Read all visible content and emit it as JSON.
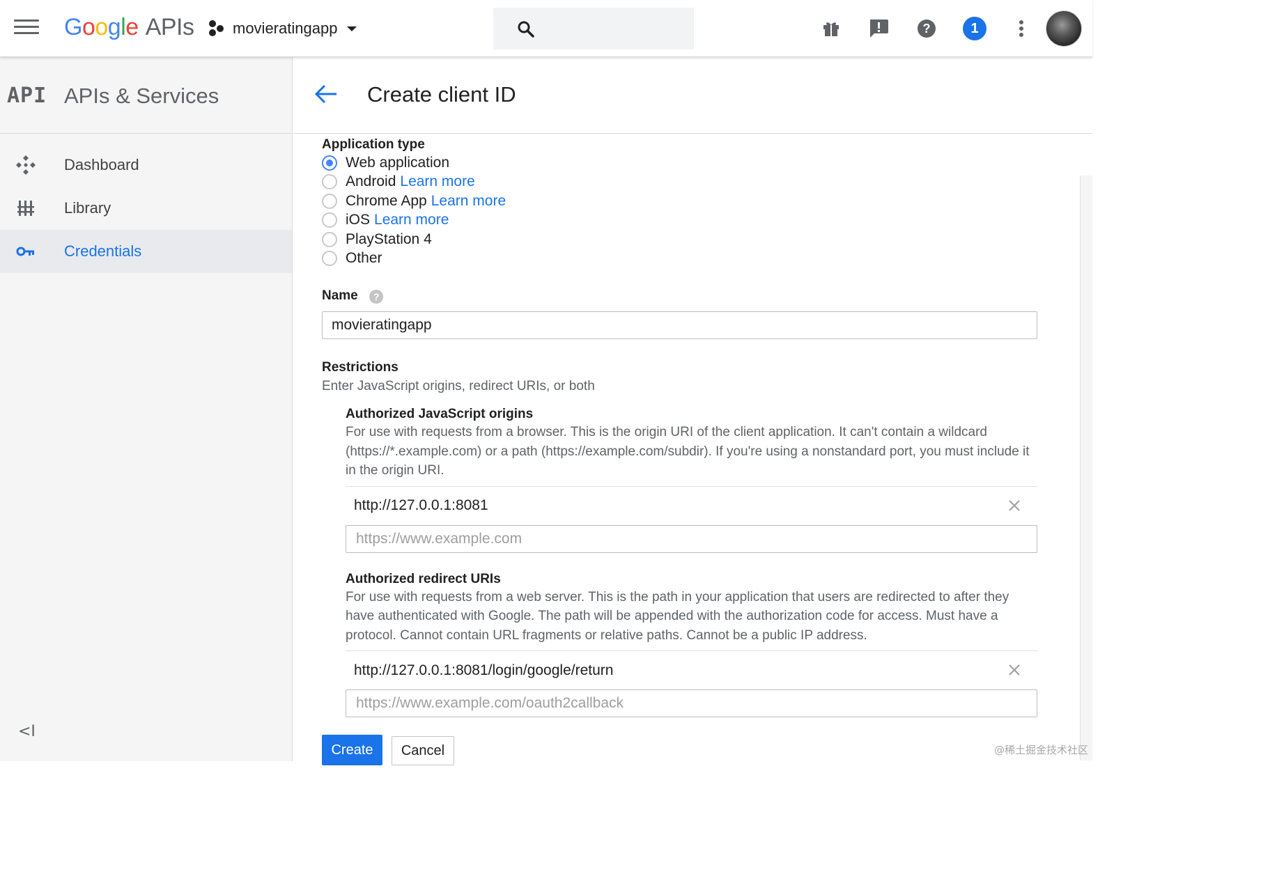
{
  "topbar": {
    "logo": {
      "g1": "G",
      "g2": "o",
      "g3": "o",
      "g4": "g",
      "g5": "l",
      "g6": "e",
      "apis": "APIs"
    },
    "project_name": "movieratingapp",
    "notification_count": "1",
    "icons": [
      "menu-icon",
      "project-icon",
      "search-icon",
      "gift-icon",
      "feedback-icon",
      "help-icon",
      "more-vert-icon"
    ]
  },
  "sidebar": {
    "logo_text": "API",
    "title": "APIs & Services",
    "items": [
      {
        "label": "Dashboard",
        "icon": "dashboard-icon"
      },
      {
        "label": "Library",
        "icon": "library-icon"
      },
      {
        "label": "Credentials",
        "icon": "key-icon",
        "active": true
      }
    ],
    "collapse_label": "<I"
  },
  "page": {
    "title": "Create client ID"
  },
  "form": {
    "app_type_label": "Application type",
    "app_types": [
      {
        "label": "Web application",
        "learn": "",
        "checked": true
      },
      {
        "label": "Android",
        "learn": "Learn more"
      },
      {
        "label": "Chrome App",
        "learn": "Learn more"
      },
      {
        "label": "iOS",
        "learn": "Learn more"
      },
      {
        "label": "PlayStation 4",
        "learn": ""
      },
      {
        "label": "Other",
        "learn": ""
      }
    ],
    "name_label": "Name",
    "name_help": "?",
    "name_value": "movieratingapp",
    "restrictions_label": "Restrictions",
    "restrictions_sub": "Enter JavaScript origins, redirect URIs, or both",
    "js_origins": {
      "title": "Authorized JavaScript origins",
      "description": "For use with requests from a browser. This is the origin URI of the client application. It can't contain a wildcard (https://*.example.com) or a path (https://example.com/subdir). If you're using a nonstandard port, you must include it in the origin URI.",
      "entry": "http://127.0.0.1:8081",
      "placeholder": "https://www.example.com"
    },
    "redirect_uris": {
      "title": "Authorized redirect URIs",
      "description": "For use with requests from a web server. This is the path in your application that users are redirected to after they have authenticated with Google. The path will be appended with the authorization code for access. Must have a protocol. Cannot contain URL fragments or relative paths. Cannot be a public IP address.",
      "entry": "http://127.0.0.1:8081/login/google/return",
      "placeholder": "https://www.example.com/oauth2callback"
    },
    "create_label": "Create",
    "cancel_label": "Cancel"
  },
  "watermark": "@稀土掘金技术社区",
  "colors": {
    "accent": "#1a73e8",
    "radio_checked": "#4285f4"
  }
}
